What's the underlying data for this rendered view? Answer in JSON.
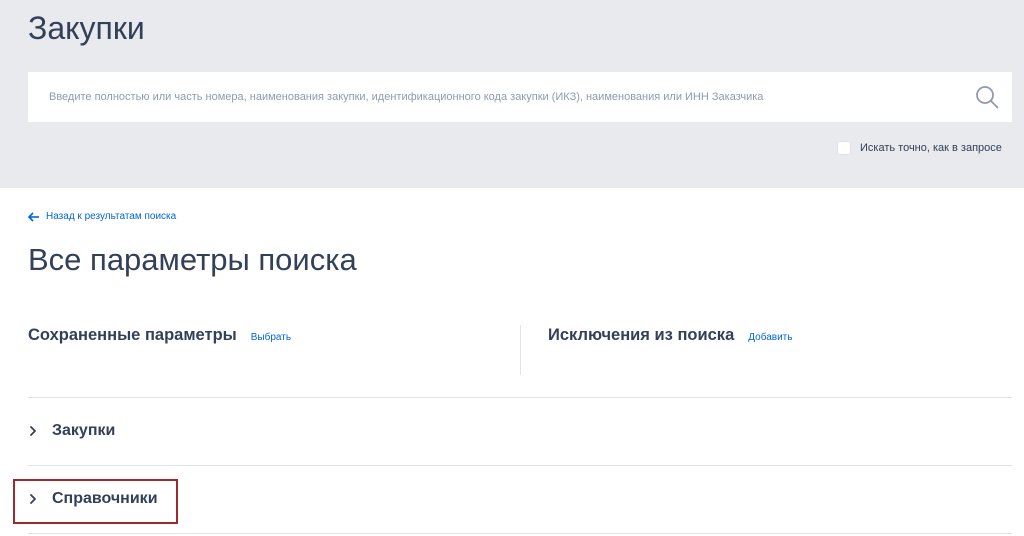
{
  "header": {
    "title": "Закупки"
  },
  "search": {
    "placeholder": "Введите полностью или часть номера, наименования закупки, идентификационного кода закупки (ИКЗ), наименования или ИНН Заказчика",
    "value": "",
    "icon": "search-icon",
    "exact_match_label": "Искать точно, как в запросе",
    "exact_match_checked": false
  },
  "nav": {
    "back_label": "Назад к результатам поиска"
  },
  "main": {
    "title": "Все параметры поиска",
    "saved_params": {
      "title": "Сохраненные параметры",
      "action": "Выбрать"
    },
    "exclusions": {
      "title": "Исключения из поиска",
      "action": "Добавить"
    },
    "sections": [
      {
        "label": "Закупки",
        "expanded": false
      },
      {
        "label": "Справочники",
        "expanded": false,
        "highlighted": true
      }
    ]
  },
  "colors": {
    "text": "#334059",
    "link": "#0065dd",
    "band": "#e8eaee",
    "highlight": "#9e2a2f"
  }
}
